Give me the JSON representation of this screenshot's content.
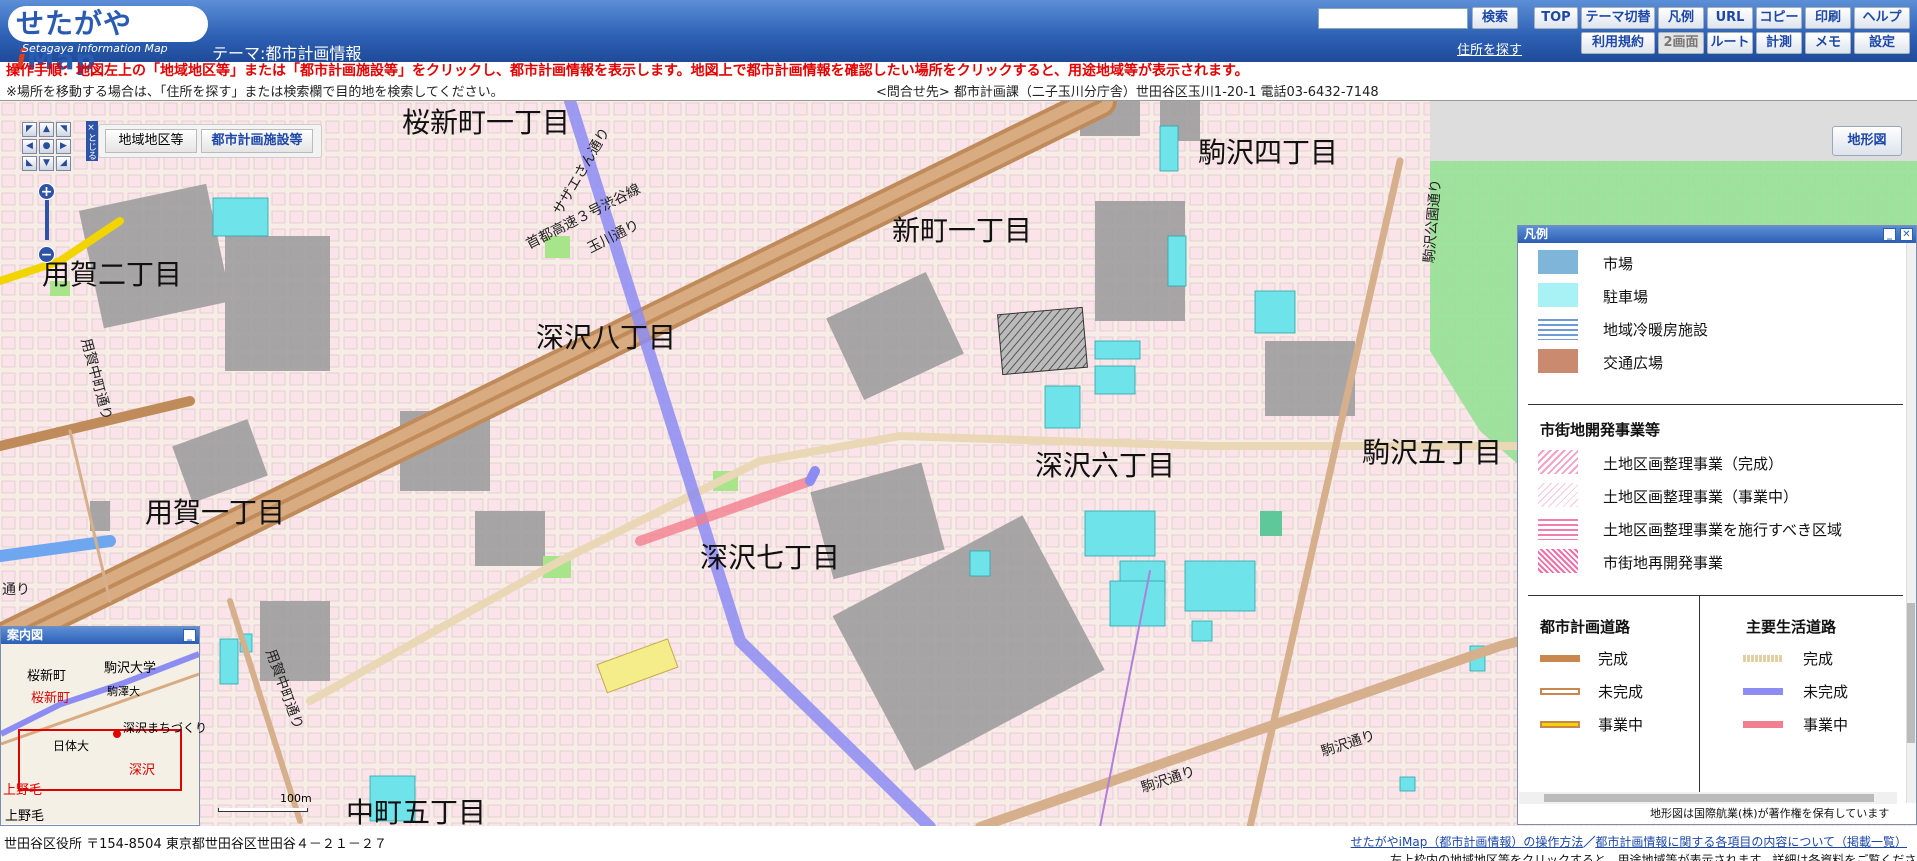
{
  "header": {
    "logo_title": "せたがや",
    "logo_i": "i",
    "logo_map": "Map",
    "logo_subtitle": "Setagaya information Map",
    "theme": "テーマ:都市計画情報",
    "search_value": "",
    "search_button": "検索",
    "address_search": "住所を探す",
    "buttons_row1": [
      "TOP",
      "テーマ切替",
      "凡例",
      "URL",
      "コピー",
      "印刷",
      "ヘルプ"
    ],
    "buttons_row2": [
      "利用規約",
      "2画面",
      "ルート",
      "計測",
      "メモ",
      "設定"
    ]
  },
  "instruction": "操作手順：地図左上の「地域地区等」または「都市計画施設等」をクリックし、都市計画情報を表示します。地図上で都市計画情報を確認したい場所をクリックすると、用途地域等が表示されます。",
  "note": "※場所を移動する場合は、「住所を探す」または検索欄で目的地を検索してください。",
  "contact": "<問合せ先> 都市計画課（二子玉川分庁舎）世田谷区玉川1-20-1 電話03-6432-7148",
  "map": {
    "tabs": [
      "地域地区等",
      "都市計画施設等"
    ],
    "collapse_label": "×とじる",
    "terrain_button": "地形図",
    "towns": [
      "桜新町一丁目",
      "駒沢四丁目",
      "用賀二丁目",
      "新町一丁目",
      "深沢八丁目",
      "深沢六丁目",
      "駒沢五丁目",
      "用賀一丁目",
      "深沢七丁目",
      "中町五丁目"
    ],
    "roads": [
      "首都高速３号渋谷線",
      "玉川通り",
      "サザエさん通り",
      "駒沢通り",
      "駒沢通り",
      "用賀中町通り",
      "用賀中町通り",
      "通り",
      "駒沢公園通り"
    ],
    "scale": "100m"
  },
  "legend": {
    "title": "凡例",
    "items": [
      {
        "label": "市場",
        "color": "#7fb5d8"
      },
      {
        "label": "駐車場",
        "color": "#a8f2f5"
      },
      {
        "label": "地域冷暖房施設",
        "color": "#6f9ad6"
      },
      {
        "label": "交通広場",
        "color": "#c98a6f"
      }
    ],
    "redevelopment_heading": "市街地開発事業等",
    "redevelopment_items": [
      {
        "label": "土地区画整理事業（完成）",
        "color": "#f2a2c8"
      },
      {
        "label": "土地区画整理事業（事業中）",
        "color": "#f7c6dc"
      },
      {
        "label": "土地区画整理事業を施行すべき区域",
        "color": "#ef7fb3"
      },
      {
        "label": "市街地再開発事業",
        "color": "#ee6fa9"
      }
    ],
    "urban_road_heading": "都市計画道路",
    "main_road_heading": "主要生活道路",
    "urban_roads": [
      {
        "label": "完成",
        "color": "#c9874f"
      },
      {
        "label": "未完成",
        "color": "#e7b58a"
      },
      {
        "label": "事業中",
        "color": "#f1d400"
      }
    ],
    "main_roads": [
      {
        "label": "完成",
        "color": "#e2cfa4"
      },
      {
        "label": "未完成",
        "color": "#8c8cf2"
      },
      {
        "label": "事業中",
        "color": "#f27f8f"
      }
    ],
    "copyright": "地形図は国際航業(株)が著作権を保有しています"
  },
  "guide": {
    "title": "案内図",
    "labels": [
      "桜新町",
      "駒沢大学",
      "桜新町",
      "駒澤大",
      "深沢まちづくり",
      "日体大",
      "深沢",
      "上野毛",
      "上野毛"
    ]
  },
  "footer": {
    "address": "世田谷区役所 〒154-8504 東京都世田谷区世田谷４－２１－２７",
    "link1": "せたがやiMap（都市計画情報）の操作方法",
    "separator": "／",
    "link2": "都市計画情報に関する各項目の内容について（掲載一覧）",
    "note": "左上枠内の地域地区等をクリックすると、用途地域等が表示されます。詳細は各資料をご覧ください。"
  }
}
